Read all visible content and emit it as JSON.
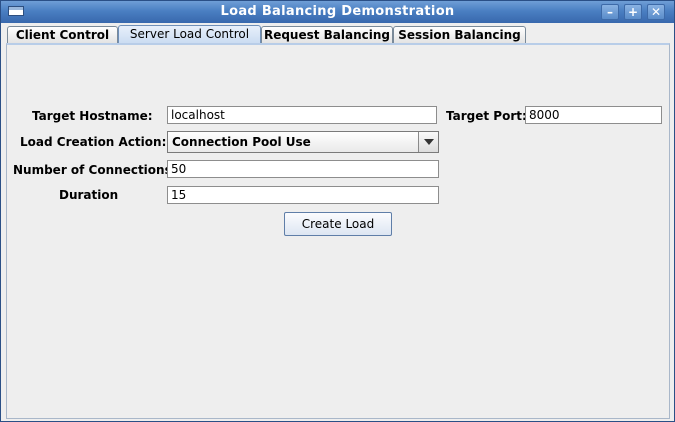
{
  "window": {
    "title": "Load Balancing Demonstration",
    "controls": {
      "minimize": "–",
      "maximize": "+",
      "close": "✕"
    }
  },
  "tabs": [
    {
      "label": "Client Control",
      "selected": false
    },
    {
      "label": "Server Load Control",
      "selected": true
    },
    {
      "label": "Request Balancing",
      "selected": false
    },
    {
      "label": "Session Balancing",
      "selected": false
    }
  ],
  "form": {
    "target_hostname_label": "Target Hostname:",
    "target_hostname_value": "localhost",
    "target_port_label": "Target Port:",
    "target_port_value": "8000",
    "load_action_label": "Load Creation Action:",
    "load_action_value": "Connection Pool Use",
    "connections_label": "Number of Connections",
    "connections_value": "50",
    "duration_label": "Duration",
    "duration_value": "15",
    "create_load_button": "Create Load"
  },
  "icons": {
    "window_menu": "window-menu-icon",
    "combo_arrow": "chevron-down-icon"
  },
  "colors": {
    "titlebar": "#4a7fc2",
    "selected_tab": "#c9dbf1",
    "panel_background": "#eeeeee"
  }
}
